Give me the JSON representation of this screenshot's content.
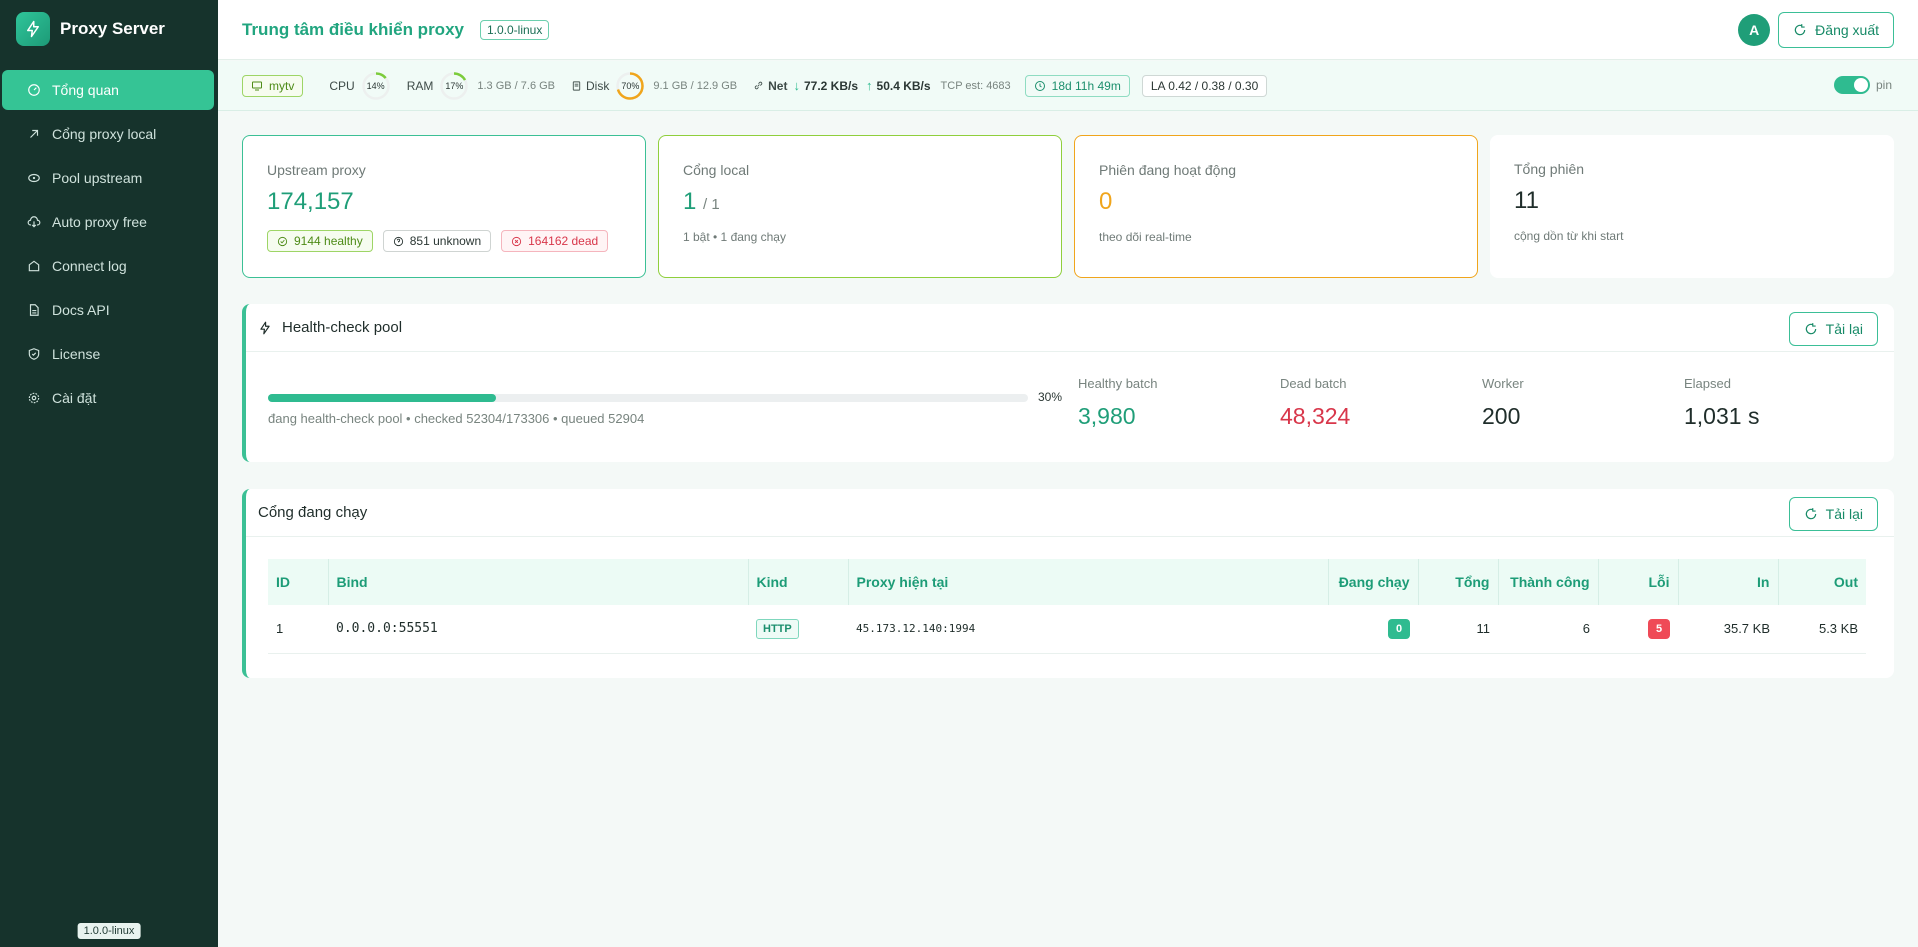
{
  "app": {
    "title": "Proxy Server",
    "version": "1.0.0-linux"
  },
  "sidebar": {
    "items": [
      {
        "label": "Tổng quan",
        "icon": "dashboard-icon",
        "active": true
      },
      {
        "label": "Cổng proxy local",
        "icon": "plug-icon"
      },
      {
        "label": "Pool upstream",
        "icon": "pool-icon"
      },
      {
        "label": "Auto proxy free",
        "icon": "cloud-download-icon"
      },
      {
        "label": "Connect log",
        "icon": "log-icon"
      },
      {
        "label": "Docs API",
        "icon": "document-icon"
      },
      {
        "label": "License",
        "icon": "shield-icon"
      },
      {
        "label": "Cài đặt",
        "icon": "gear-icon"
      }
    ]
  },
  "header": {
    "title": "Trung tâm điều khiển proxy",
    "version": "1.0.0-linux",
    "avatar": "A",
    "logout_label": "Đăng xuất"
  },
  "status": {
    "host": "mytv",
    "cpu_label": "CPU",
    "cpu_pct": 14,
    "cpu_text": "14%",
    "ram_label": "RAM",
    "ram_pct": 17,
    "ram_text": "17%",
    "ram_usage": "1.3 GB / 7.6 GB",
    "disk_label": "Disk",
    "disk_pct": 70,
    "disk_text": "70%",
    "disk_usage": "9.1 GB / 12.9 GB",
    "net_label": "Net",
    "net_down": "77.2 KB/s",
    "net_up": "50.4 KB/s",
    "tcp": "TCP est: 4683",
    "uptime": "18d 11h 49m",
    "load": "LA 0.42 / 0.38 / 0.30",
    "pin_label": "pin"
  },
  "cards": {
    "upstream": {
      "label": "Upstream proxy",
      "value": "174,157",
      "healthy": "9144 healthy",
      "unknown": "851 unknown",
      "dead": "164162 dead"
    },
    "local": {
      "label": "Cổng local",
      "value": "1",
      "total": "/ 1",
      "sub": "1 bật • 1 đang chạy"
    },
    "sessions": {
      "label": "Phiên đang hoạt động",
      "value": "0",
      "sub": "theo dõi real-time"
    },
    "total_sessions": {
      "label": "Tổng phiên",
      "value": "11",
      "sub": "cộng dồn từ khi start"
    }
  },
  "health": {
    "title": "Health-check pool",
    "reload_label": "Tải lại",
    "progress": 30,
    "progress_text": "30%",
    "status_text": "đang health-check pool • checked 52304/173306 • queued 52904",
    "stats": [
      {
        "label": "Healthy batch",
        "value": "3,980"
      },
      {
        "label": "Dead batch",
        "value": "48,324"
      },
      {
        "label": "Worker",
        "value": "200"
      },
      {
        "label": "Elapsed",
        "value": "1,031 s"
      }
    ]
  },
  "ports": {
    "title": "Cổng đang chạy",
    "reload_label": "Tải lại",
    "columns": [
      "ID",
      "Bind",
      "Kind",
      "Proxy hiện tại",
      "Đang chạy",
      "Tổng",
      "Thành công",
      "Lỗi",
      "In",
      "Out"
    ],
    "rows": [
      {
        "id": "1",
        "bind": "0.0.0.0:55551",
        "kind": "HTTP",
        "proxy": "45.173.12.140:1994",
        "running": "0",
        "total": "11",
        "success": "6",
        "errors": "5",
        "in": "35.7 KB",
        "out": "5.3 KB"
      }
    ]
  },
  "colors": {
    "accent": "#2fbb90",
    "sidebar": "#16332c",
    "danger": "#d8364a",
    "warning": "#f0a51c",
    "lime": "#8fcf3c"
  }
}
